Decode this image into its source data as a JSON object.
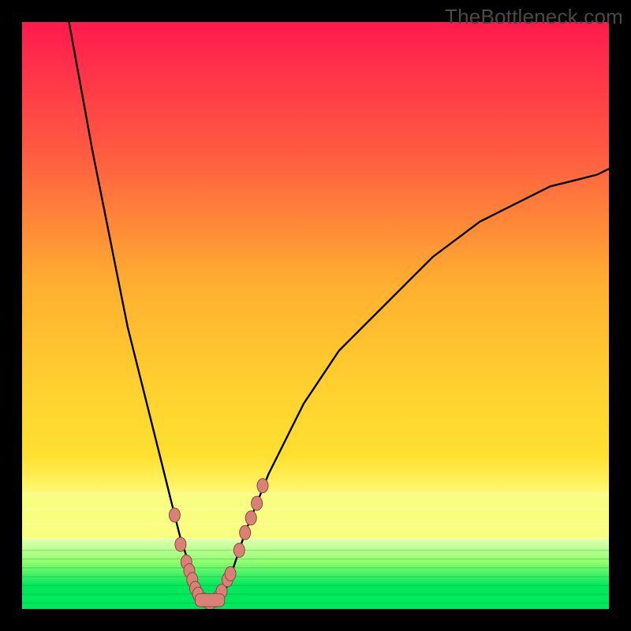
{
  "watermark": "TheBottleneck.com",
  "colors": {
    "bg_black": "#000000",
    "grad_top": "#ff1a4d",
    "grad_mid1": "#ff6a3a",
    "grad_mid2": "#ffb030",
    "grad_mid3": "#ffe030",
    "grad_band_light": "#f8ff80",
    "grad_green_light": "#8dff5a",
    "grad_green": "#00e85c",
    "curve": "#000000",
    "marker_fill": "#d98077",
    "marker_stroke": "#8a4a42"
  },
  "chart_data": {
    "type": "line",
    "title": "",
    "xlabel": "",
    "ylabel": "",
    "xlim": [
      0,
      100
    ],
    "ylim": [
      0,
      100
    ],
    "x_min_curve": 8,
    "series": [
      {
        "name": "bottleneck-curve",
        "x": [
          8,
          10,
          12,
          14,
          16,
          18,
          20,
          22,
          24,
          25,
          26,
          27,
          28,
          29,
          30,
          31,
          32,
          33,
          34,
          35,
          36,
          37,
          38,
          40,
          42,
          44,
          46,
          48,
          50,
          54,
          58,
          62,
          66,
          70,
          74,
          78,
          82,
          86,
          90,
          94,
          98,
          100
        ],
        "y": [
          100,
          89,
          78,
          68,
          58,
          48,
          40,
          32,
          24,
          20,
          16,
          12,
          9,
          6,
          4,
          2,
          1,
          1,
          2,
          4,
          7,
          10,
          13,
          18,
          23,
          27,
          31,
          35,
          38,
          44,
          48,
          52,
          56,
          60,
          63,
          66,
          68,
          70,
          72,
          73,
          74,
          75
        ]
      }
    ],
    "markers": {
      "name": "highlight-points",
      "x": [
        26,
        27,
        28,
        28.5,
        29,
        29.5,
        30,
        31,
        32,
        33,
        33.5,
        34,
        35,
        35.5,
        37,
        38,
        39,
        40,
        41
      ],
      "y": [
        16,
        11,
        8,
        6.5,
        5,
        3.5,
        2.5,
        1.5,
        1,
        1.5,
        2,
        3,
        5,
        6,
        10,
        13,
        15.5,
        18,
        21
      ]
    },
    "trough_bar": {
      "x_start": 29.5,
      "x_end": 34.5,
      "y": 1.5,
      "height": 2.2
    }
  }
}
